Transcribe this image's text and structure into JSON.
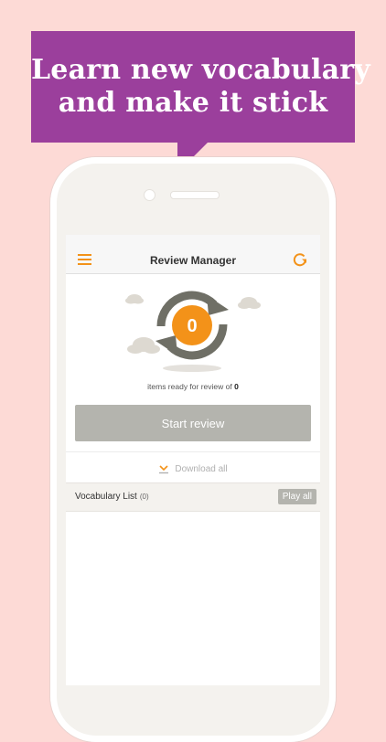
{
  "banner": {
    "line1": "Learn new vocabulary",
    "line2": "and make it stick"
  },
  "colors": {
    "background": "#fddad6",
    "banner": "#9b3f9c",
    "accent": "#f39219",
    "button_gray": "#b4b4ae",
    "cycle_gray": "#6f6f66"
  },
  "navbar": {
    "title": "Review Manager",
    "left_icon": "hamburger-menu-icon",
    "right_icon": "refresh-icon"
  },
  "review": {
    "count": "0",
    "ready_text": "items ready for review of",
    "total": "0",
    "start_label": "Start review",
    "download_label": "Download all"
  },
  "vocab": {
    "label": "Vocabulary List",
    "count": "(0)",
    "play_label": "Play all"
  }
}
